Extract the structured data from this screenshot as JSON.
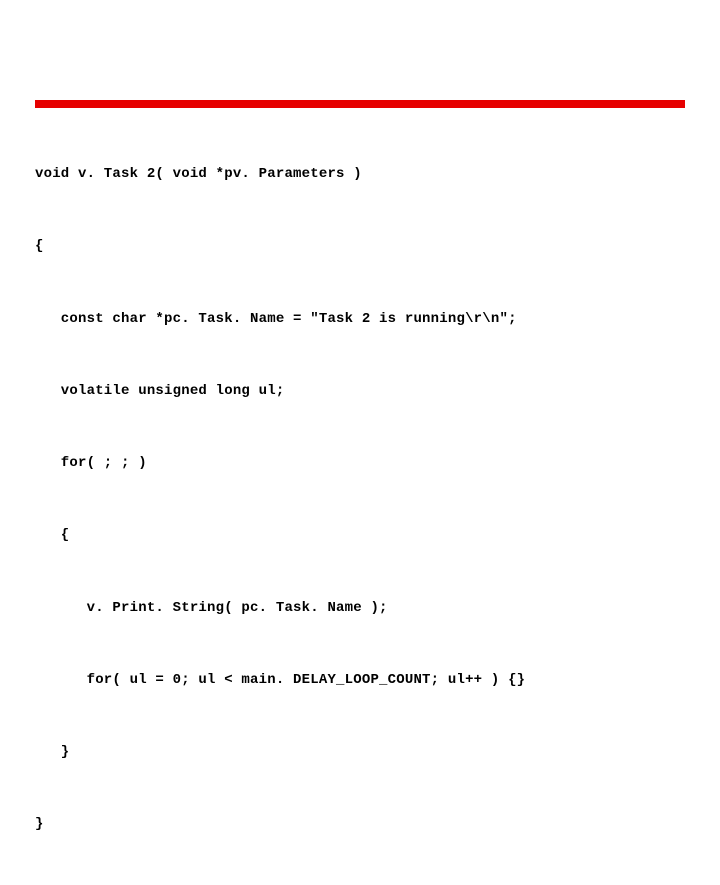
{
  "code": {
    "lines": [
      "void v. Task 2( void *pv. Parameters )",
      "{",
      "   const char *pc. Task. Name = \"Task 2 is running\\r\\n\";",
      "   volatile unsigned long ul;",
      "   for( ; ; )",
      "   {",
      "      v. Print. String( pc. Task. Name );",
      "      for( ul = 0; ul < main. DELAY_LOOP_COUNT; ul++ ) {}",
      "   }",
      "}"
    ]
  }
}
